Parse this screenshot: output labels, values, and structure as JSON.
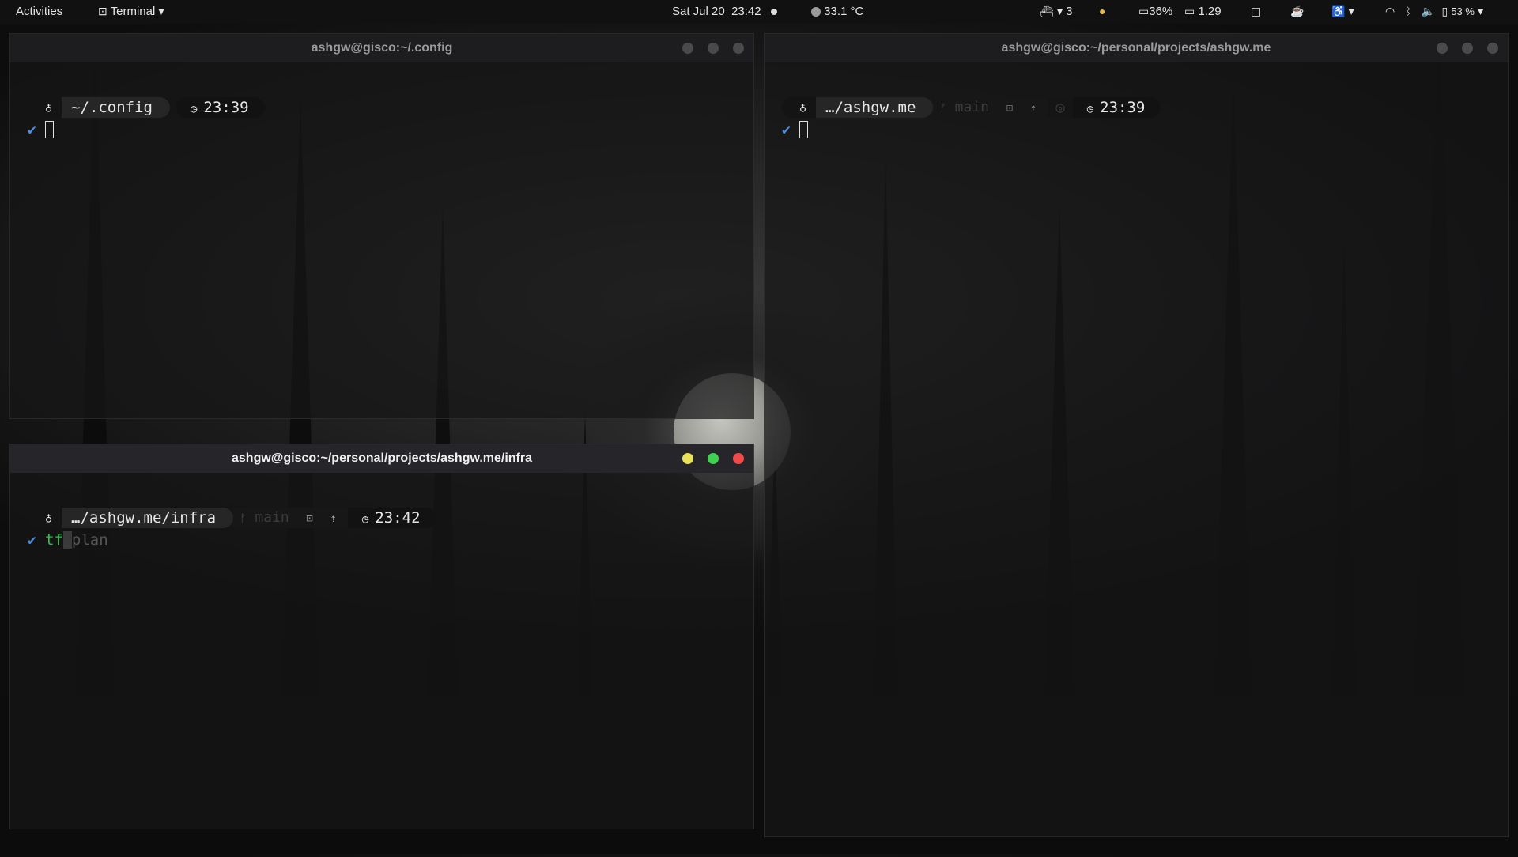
{
  "topbar": {
    "activities": "Activities",
    "app_name": "Terminal",
    "date": "Sat Jul 20",
    "time": "23:42",
    "temperature": "33.1 °C",
    "docker_count": "3",
    "cpu": "36%",
    "load": "1.29",
    "battery": "53 %"
  },
  "windows": [
    {
      "title": "ashgw@gisco:~/.config",
      "path": "~/.config",
      "git_branch": "",
      "prompt_time": "23:39",
      "command": "",
      "suggestion": ""
    },
    {
      "title": "ashgw@gisco:~/personal/projects/ashgw.me",
      "path": "…/ashgw.me",
      "git_branch": "main",
      "prompt_time": "23:39",
      "command": "",
      "suggestion": ""
    },
    {
      "title": "ashgw@gisco:~/personal/projects/ashgw.me/infra",
      "path": "…/ashgw.me/infra",
      "git_branch": "main",
      "prompt_time": "23:42",
      "command": "tf",
      "suggestion": "plan"
    }
  ],
  "colors": {
    "accent_check": "#4d8fe0",
    "command_green": "#34c24a",
    "close": "#ef4b4b",
    "maximize": "#3fd14f",
    "minimize": "#e8e25a"
  },
  "icons": {
    "os": "linux-icon",
    "clock": "clock-icon",
    "git": "git-branch-icon"
  }
}
